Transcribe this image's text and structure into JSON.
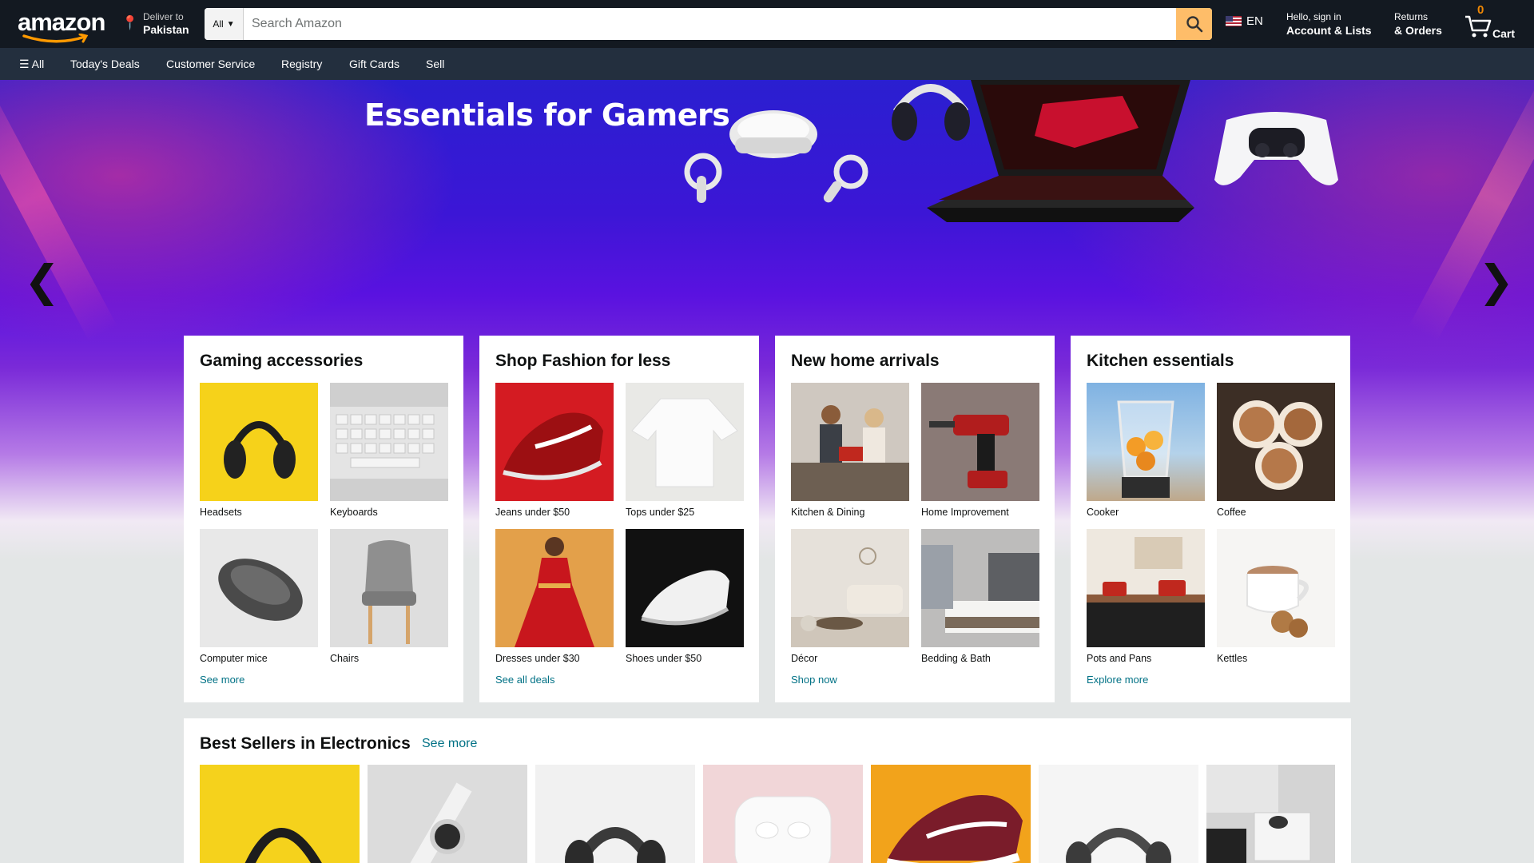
{
  "header": {
    "logo_text": "amazon",
    "deliver_line1": "Deliver to",
    "deliver_line2": "Pakistan",
    "search_category": "All",
    "search_placeholder": "Search Amazon",
    "language": "EN",
    "account_line1": "Hello, sign in",
    "account_line2": "Account & Lists",
    "returns_line1": "Returns",
    "returns_line2": "& Orders",
    "cart_count": "0",
    "cart_label": "Cart"
  },
  "nav": {
    "all": "☰ All",
    "items": [
      "Today's Deals",
      "Customer Service",
      "Registry",
      "Gift Cards",
      "Sell"
    ]
  },
  "hero": {
    "title": "Essentials for Gamers",
    "prev": "❮",
    "next": "❯"
  },
  "cards": [
    {
      "title": "Gaming accessories",
      "tiles": [
        "Headsets",
        "Keyboards",
        "Computer mice",
        "Chairs"
      ],
      "link": "See more"
    },
    {
      "title": "Shop Fashion for less",
      "tiles": [
        "Jeans under $50",
        "Tops under $25",
        "Dresses under $30",
        "Shoes under $50"
      ],
      "link": "See all deals"
    },
    {
      "title": "New home arrivals",
      "tiles": [
        "Kitchen & Dining",
        "Home Improvement",
        "Décor",
        "Bedding & Bath"
      ],
      "link": "Shop now"
    },
    {
      "title": "Kitchen essentials",
      "tiles": [
        "Cooker",
        "Coffee",
        "Pots and Pans",
        "Kettles"
      ],
      "link": "Explore more"
    }
  ],
  "best_sellers": {
    "title": "Best Sellers in Electronics",
    "link": "See more"
  },
  "colors": {
    "header_bg": "#131921",
    "nav_bg": "#232f3e",
    "search_button": "#febd69",
    "cart_count": "#f08804",
    "link": "#007185"
  }
}
